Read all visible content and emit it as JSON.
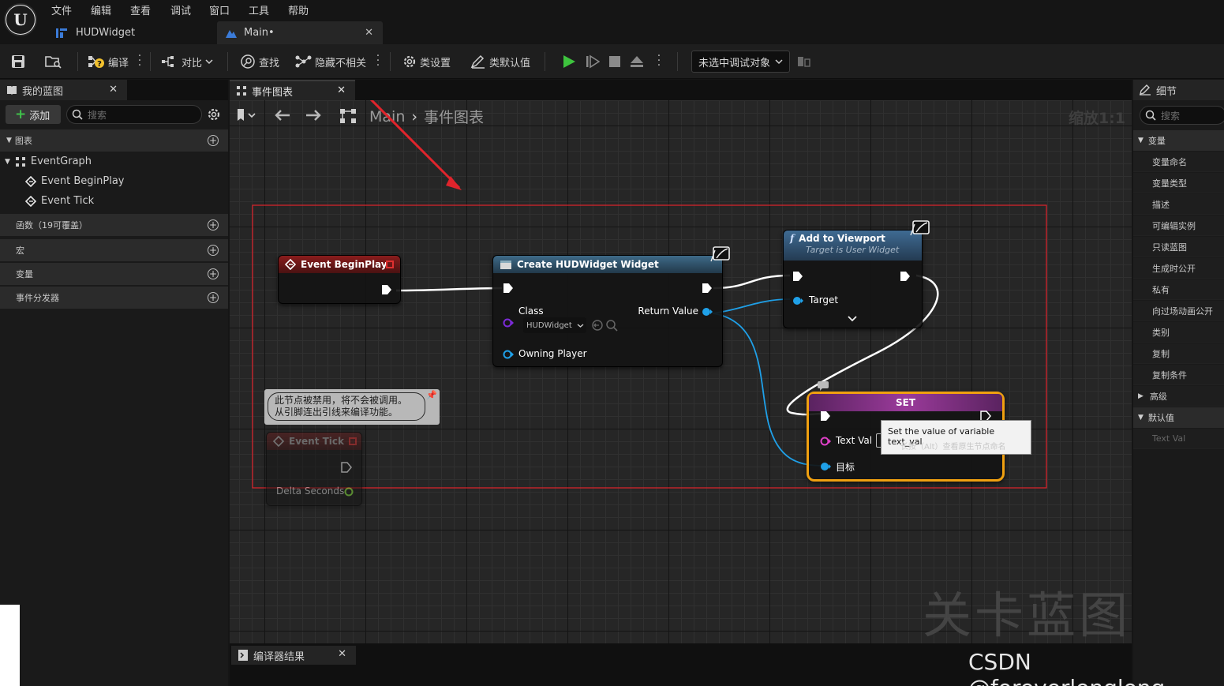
{
  "menu": [
    "文件",
    "编辑",
    "查看",
    "调试",
    "窗口",
    "工具",
    "帮助"
  ],
  "logo_text": "U",
  "doc_tabs": [
    {
      "label": "HUDWidget",
      "active": false
    },
    {
      "label": "Main•",
      "active": true
    }
  ],
  "toolbar": {
    "compile": "编译",
    "diff": "对比",
    "find": "查找",
    "hide_unrelated": "隐藏不相关",
    "class_settings": "类设置",
    "class_defaults": "类默认值",
    "debug_target": "未选中调试对象"
  },
  "my_blueprint": {
    "tab": "我的蓝图",
    "add": "添加",
    "search_placeholder": "搜索",
    "sections": {
      "graphs": "图表",
      "functions": "函数（19可覆盖）",
      "macros": "宏",
      "variables": "变量",
      "dispatchers": "事件分发器"
    },
    "tree": {
      "event_graph": "EventGraph",
      "begin_play": "Event BeginPlay",
      "tick": "Event Tick"
    }
  },
  "graph": {
    "tab": "事件图表",
    "breadcrumb": [
      "Main",
      "事件图表"
    ],
    "zoom": "缩放1:1",
    "watermark": "关卡蓝图"
  },
  "nodes": {
    "begin_play": {
      "title": "Event BeginPlay"
    },
    "create_widget": {
      "title": "Create HUDWidget Widget",
      "class_label": "Class",
      "class_value": "HUDWidget",
      "return_label": "Return Value",
      "owning_player": "Owning Player"
    },
    "add_to_viewport": {
      "title": "Add to Viewport",
      "subtitle": "Target is User Widget",
      "target": "Target"
    },
    "tick": {
      "title": "Event Tick",
      "delta": "Delta Seconds",
      "disabled_comment_line1": "此节点被禁用，将不会被调用。",
      "disabled_comment_line2": "从引脚连出引线来编译功能。"
    },
    "set": {
      "title": "SET",
      "text_val": "Text Val",
      "target": "目标",
      "tooltip": "Set the value of variable text_val",
      "tooltip_hint": "长按（Alt）查看原生节点命名"
    }
  },
  "compiler_results": {
    "tab": "编译器结果"
  },
  "details": {
    "tab": "细节",
    "search_placeholder": "搜索",
    "variable_header": "变量",
    "rows": [
      "变量命名",
      "变量类型",
      "描述",
      "可编辑实例",
      "只读蓝图",
      "生成时公开",
      "私有",
      "向过场动画公开",
      "类别",
      "复制",
      "复制条件"
    ],
    "advanced": "高级",
    "defaults_header": "默认值",
    "default_row": "Text Val"
  },
  "watermark_csdn": "CSDN @foreverlonglong",
  "colors": {
    "exec": "#ffffff",
    "object_pin": "#1fa0e8",
    "class_pin": "#7c2bd8",
    "text_pin": "#e040c8",
    "annotation_red": "#e0242c",
    "set_border": "#f0a010"
  }
}
